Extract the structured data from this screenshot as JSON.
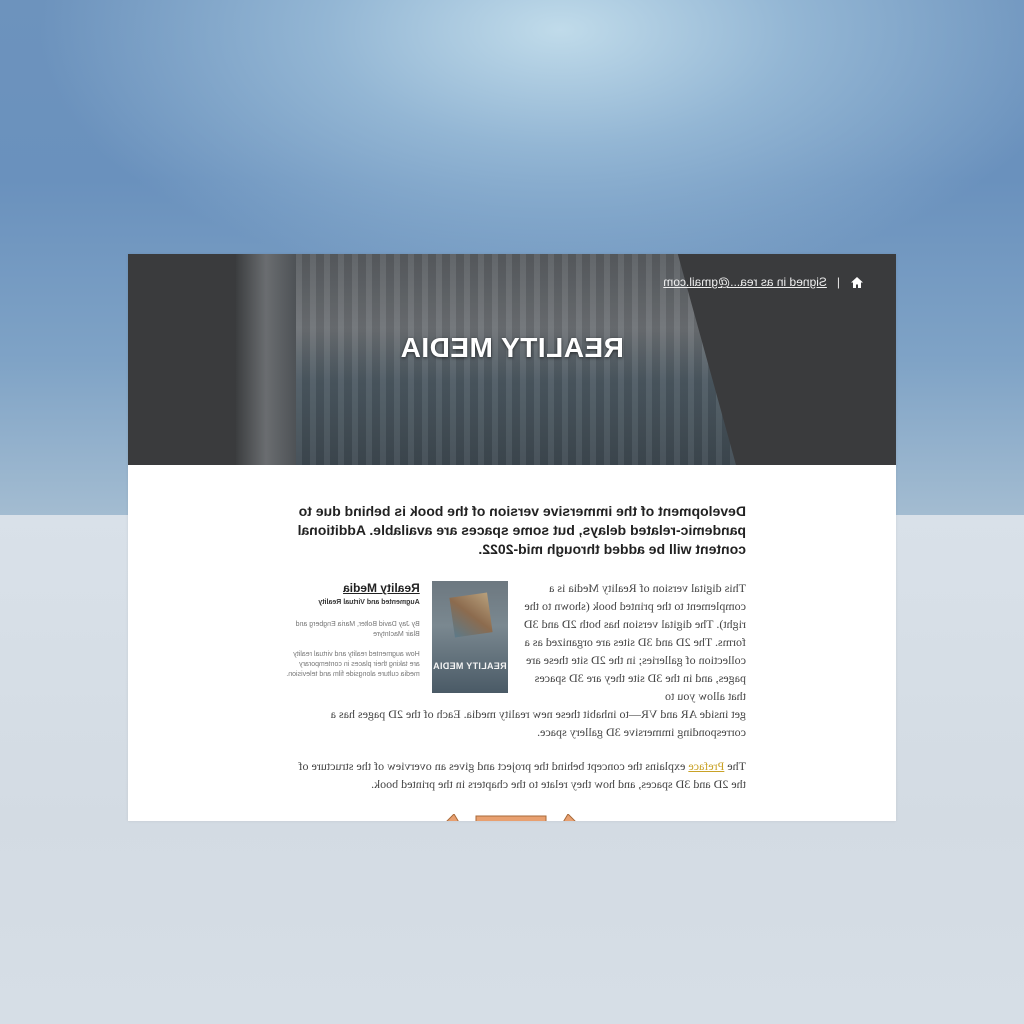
{
  "header": {
    "site_title": "REALITY MEDIA",
    "signed_in_text": "Signed in as rea...@gmail.com",
    "separator": "|",
    "home_icon": "home-icon"
  },
  "notice": "Development of the immersive version of the book is behind due to pandemic-related delays, but some spaces are available. Additional content will be added through mid-2022.",
  "intro": {
    "text": "This digital version of Reality Media is a complement to the printed book (shown to the right). The digital version has both 2D and 3D forms. The 2D and 3D sites are organized as a collection of galleries; in the 2D site these are pages, and in the 3D site they are 3D spaces that allow you to",
    "continuation": "get inside AR and VR—to inhabit these new reality media. Each of the 2D pages has a corresponding immersive 3D gallery space."
  },
  "book": {
    "cover_title": "REALITY MEDIA",
    "title": "Reality Media",
    "subtitle": "Augmented and Virtual Reality",
    "authors": "By Jay David Bolter, Maria Engberg and Blair MacIntyre",
    "description": "How augmented reality and virtual reality are taking their places in contemporary media culture alongside film and television."
  },
  "preface": {
    "before": "The ",
    "link": "Preface",
    "after": " explains the concept behind the project and gives an overview of the structure of the 2D and 3D spaces, and how they relate to the chapters in the printed book."
  },
  "colors": {
    "link": "#c9a227",
    "arrow": "#e8a070"
  }
}
